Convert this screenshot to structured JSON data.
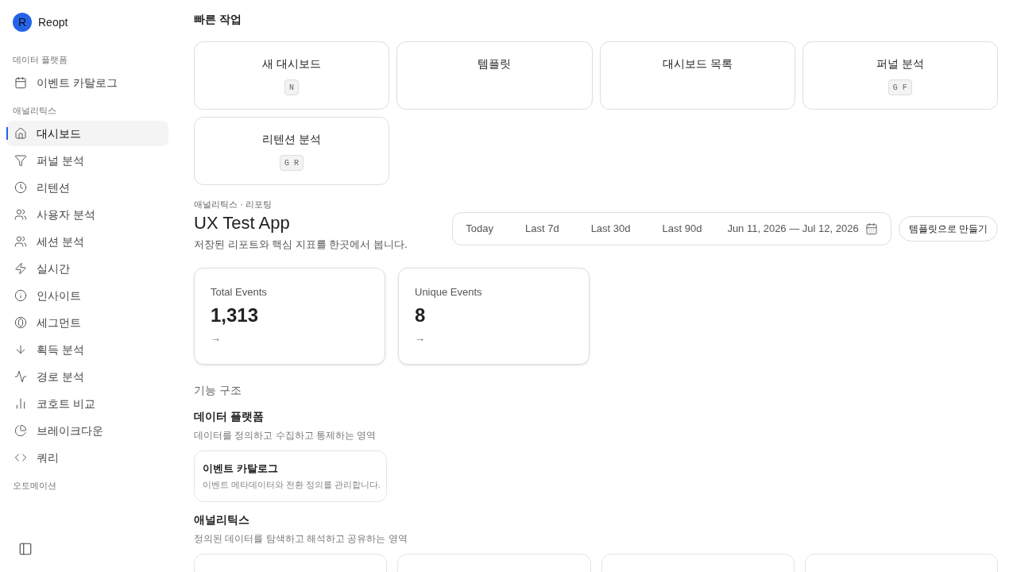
{
  "sidebar": {
    "brand": {
      "avatar": "R",
      "name": "Reopt"
    },
    "sections": [
      {
        "label": "데이터 플랫폼",
        "items": [
          {
            "label": "이벤트 카탈로그",
            "selected": false
          }
        ]
      },
      {
        "label": "애널리틱스",
        "items": [
          {
            "label": "대시보드",
            "selected": true
          },
          {
            "label": "퍼널 분석",
            "selected": false
          },
          {
            "label": "리텐션",
            "selected": false
          },
          {
            "label": "사용자 분석",
            "selected": false
          },
          {
            "label": "세션 분석",
            "selected": false
          },
          {
            "label": "실시간",
            "selected": false
          },
          {
            "label": "인사이트",
            "selected": false
          },
          {
            "label": "세그먼트",
            "selected": false
          },
          {
            "label": "획득 분석",
            "selected": false
          },
          {
            "label": "경로 분석",
            "selected": false
          },
          {
            "label": "코호트 비교",
            "selected": false
          },
          {
            "label": "브레이크다운",
            "selected": false
          },
          {
            "label": "쿼리",
            "selected": false
          }
        ]
      },
      {
        "label": "오토메이션"
      }
    ]
  },
  "quick_actions": {
    "title": "빠른 작업",
    "items": [
      {
        "label": "새 대시보드",
        "shortcut": "N"
      },
      {
        "label": "템플릿"
      },
      {
        "label": "대시보드 목록"
      },
      {
        "label": "퍼널 분석",
        "shortcut": "G F"
      },
      {
        "label": "리텐션 분석",
        "shortcut": "G R"
      }
    ]
  },
  "header": {
    "breadcrumb": "애널리틱스 · 리포팅",
    "title": "UX Test App",
    "subtitle": "저장된 리포트와 핵심 지표를 한곳에서 봅니다.",
    "ranges": [
      "Today",
      "Last 7d",
      "Last 30d",
      "Last 90d"
    ],
    "date_range": "Jun 11, 2026 — Jul 12, 2026",
    "template_button": "템플릿으로 만들기"
  },
  "metrics": [
    {
      "label": "Total Events",
      "value": "1,313",
      "arrow": "→"
    },
    {
      "label": "Unique Events",
      "value": "8",
      "arrow": "→"
    }
  ],
  "features": {
    "heading": "기능 구조",
    "groups": [
      {
        "title": "데이터 플랫폼",
        "description": "데이터를 정의하고 수집하고 통제하는 영역",
        "cards": [
          {
            "kind": "card",
            "title": "이벤트 카탈로그",
            "description": "이벤트 메타데이터와 전환 정의를 관리합니다."
          }
        ]
      },
      {
        "title": "애널리틱스",
        "description": "정의된 데이터를 탐색하고 해석하고 공유하는 영역",
        "cards": [
          {
            "kind": "hidden"
          },
          {
            "kind": "hidden"
          },
          {
            "kind": "hidden"
          },
          {
            "kind": "hidden"
          }
        ]
      }
    ]
  }
}
